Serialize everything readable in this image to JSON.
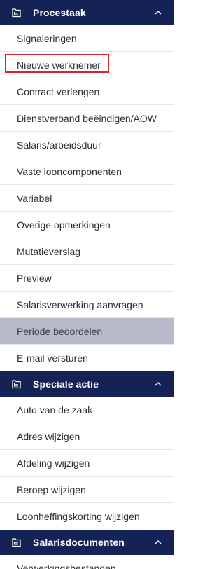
{
  "sections": [
    {
      "title": "Procestaak",
      "icon": "folder-tree-icon",
      "expanded": true,
      "items": [
        {
          "label": "Signaleringen"
        },
        {
          "label": "Nieuwe werknemer",
          "highlighted": true
        },
        {
          "label": "Contract verlengen"
        },
        {
          "label": "Dienstverband beëindigen/AOW"
        },
        {
          "label": "Salaris/arbeidsduur"
        },
        {
          "label": "Vaste looncomponenten"
        },
        {
          "label": "Variabel"
        },
        {
          "label": "Overige opmerkingen"
        },
        {
          "label": "Mutatieverslag"
        },
        {
          "label": "Preview"
        },
        {
          "label": "Salarisverwerking aanvragen"
        },
        {
          "label": "Periode beoordelen",
          "active": true
        },
        {
          "label": "E-mail versturen"
        }
      ]
    },
    {
      "title": "Speciale actie",
      "icon": "folder-tree-icon",
      "expanded": true,
      "items": [
        {
          "label": "Auto van de zaak"
        },
        {
          "label": "Adres wijzigen"
        },
        {
          "label": "Afdeling wijzigen"
        },
        {
          "label": "Beroep wijzigen"
        },
        {
          "label": "Loonheffingskorting wijzigen"
        }
      ]
    },
    {
      "title": "Salarisdocumenten",
      "icon": "folder-tree-icon",
      "expanded": true,
      "items": [
        {
          "label": "Verwerkingsbestanden"
        }
      ]
    }
  ],
  "colors": {
    "header_bg": "#142256",
    "header_text": "#ffffff",
    "item_text": "#2b2f36",
    "active_bg": "#b7bac8",
    "divider": "#e3e6ec",
    "highlight_border": "#d8262c"
  }
}
